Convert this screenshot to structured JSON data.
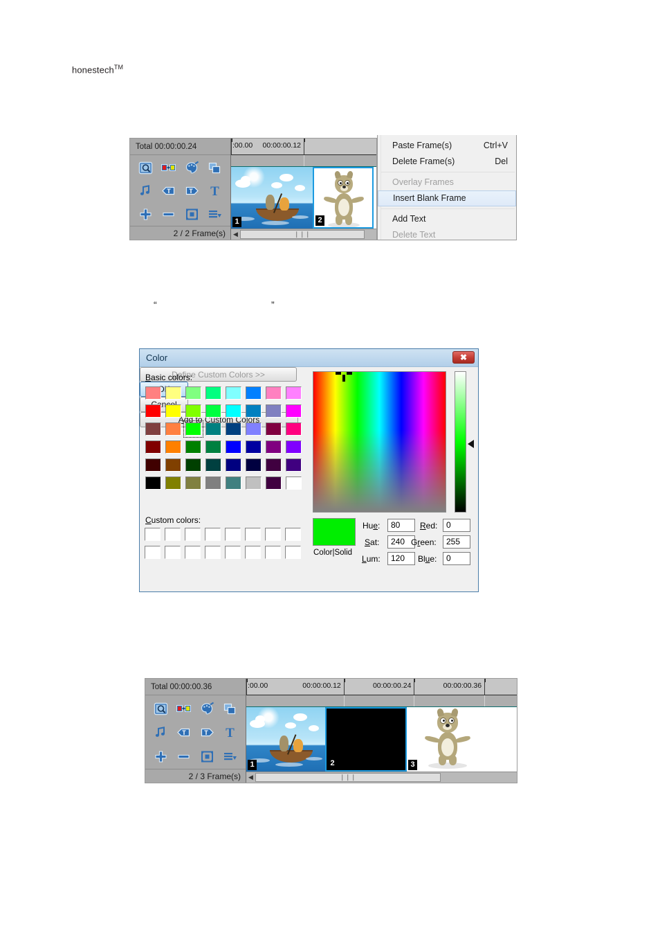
{
  "page": {
    "brand": "honestech",
    "brand_tm": "TM",
    "quote_open": "“",
    "quote_close": "”"
  },
  "timeline_top": {
    "total_label": "Total 00:00:00.24",
    "frames_label": "2 / 2 Frame(s)",
    "ruler_ticks": [
      {
        "label": ":00.00",
        "pos_pct": 0
      },
      {
        "label": "00:00:00.12",
        "pos_pct": 50
      }
    ],
    "scroll_grip": "❘❘❘",
    "scroll_left_arrow": "◀",
    "tools": [
      {
        "name": "preview-film-icon",
        "label": "Preview"
      },
      {
        "name": "replace-frame-icon",
        "label": "Replace Frame"
      },
      {
        "name": "palette-icon",
        "label": "Color"
      },
      {
        "name": "duplicate-frame-icon",
        "label": "Duplicate"
      },
      {
        "name": "audio-note-icon",
        "label": "Audio"
      },
      {
        "name": "text-left-icon",
        "label": "Text Left"
      },
      {
        "name": "text-right-icon",
        "label": "Text Right"
      },
      {
        "name": "text-tool-icon",
        "label": "Text"
      },
      {
        "name": "add-icon",
        "label": "Add"
      },
      {
        "name": "remove-icon",
        "label": "Remove"
      },
      {
        "name": "fit-icon",
        "label": "Fit"
      },
      {
        "name": "list-menu-icon",
        "label": "Menu"
      }
    ],
    "frames": [
      {
        "number": "1",
        "kind": "boat-scene",
        "selected": false
      },
      {
        "number": "2",
        "kind": "wolf-scene",
        "selected": true
      }
    ]
  },
  "context_menu": {
    "items": [
      {
        "label": "Paste Frame(s)",
        "accel": "Ctrl+V",
        "state": "normal"
      },
      {
        "label": "Delete Frame(s)",
        "accel": "Del",
        "state": "normal"
      },
      {
        "separator": true
      },
      {
        "label": "Overlay Frames",
        "accel": "",
        "state": "disabled"
      },
      {
        "label": "Insert Blank Frame",
        "accel": "",
        "state": "highlighted"
      },
      {
        "separator": true
      },
      {
        "label": "Add Text",
        "accel": "",
        "state": "normal"
      },
      {
        "label": "Delete Text",
        "accel": "",
        "state": "disabled"
      }
    ]
  },
  "color_dialog": {
    "title": "Color",
    "close_glyph": "✖",
    "basic_colors_label_pre": "B",
    "basic_colors_label_rest": "asic colors:",
    "custom_colors_label_pre": "C",
    "custom_colors_label_rest": "ustom colors:",
    "define_custom_pre": "D",
    "define_custom_rest": "efine Custom Colors >>",
    "ok_label": "OK",
    "cancel_label": "Cancel",
    "add_custom_pre": "A",
    "add_custom_rest": "dd to Custom Colors",
    "color_solid_label": "Color|Solid",
    "selected_swatch_index": 18,
    "preview_color": "#00ee00",
    "basic_colors": [
      "#ff8080",
      "#ffff80",
      "#80ff80",
      "#00ff80",
      "#80ffff",
      "#0080ff",
      "#ff80c0",
      "#ff80ff",
      "#ff0000",
      "#ffff00",
      "#80ff00",
      "#00ff40",
      "#00ffff",
      "#0080c0",
      "#8080c0",
      "#ff00ff",
      "#804040",
      "#ff8040",
      "#00ff00",
      "#008080",
      "#004080",
      "#8080ff",
      "#800040",
      "#ff0080",
      "#800000",
      "#ff8000",
      "#008000",
      "#008040",
      "#0000ff",
      "#0000a0",
      "#800080",
      "#8000ff",
      "#400000",
      "#804000",
      "#004000",
      "#004040",
      "#000080",
      "#000040",
      "#400040",
      "#400080",
      "#000000",
      "#808000",
      "#808040",
      "#808080",
      "#408080",
      "#c0c0c0",
      "#400040",
      "#ffffff"
    ],
    "custom_color_count": 16,
    "fields": [
      {
        "label_pre": "Hu",
        "label_under": "e",
        "label_post": ":",
        "value": "80",
        "name": "hue-field"
      },
      {
        "label_pre": "",
        "label_under": "S",
        "label_post": "at:",
        "value": "240",
        "name": "sat-field"
      },
      {
        "label_pre": "",
        "label_under": "L",
        "label_post": "um:",
        "value": "120",
        "name": "lum-field"
      },
      {
        "label_pre": "",
        "label_under": "R",
        "label_post": "ed:",
        "value": "0",
        "name": "red-field"
      },
      {
        "label_pre": "G",
        "label_under": "r",
        "label_post": "een:",
        "value": "255",
        "name": "green-field"
      },
      {
        "label_pre": "Bl",
        "label_under": "u",
        "label_post": "e:",
        "value": "0",
        "name": "blue-field"
      }
    ]
  },
  "timeline_bottom": {
    "total_label": "Total 00:00:00.36",
    "frames_label": "2 / 3 Frame(s)",
    "ruler_ticks": [
      {
        "label": ":00.00",
        "pos_pct": 0
      },
      {
        "label": "00:00:00.12",
        "pos_pct": 36
      },
      {
        "label": "00:00:00.24",
        "pos_pct": 62
      },
      {
        "label": "00:00:00.36",
        "pos_pct": 88
      }
    ],
    "scroll_grip": "❘❘❘",
    "scroll_left_arrow": "◀",
    "frames": [
      {
        "number": "1",
        "kind": "boat-scene",
        "selected": false
      },
      {
        "number": "2",
        "kind": "black-frame",
        "selected": true
      },
      {
        "number": "3",
        "kind": "wolf-scene",
        "selected": false
      }
    ]
  }
}
